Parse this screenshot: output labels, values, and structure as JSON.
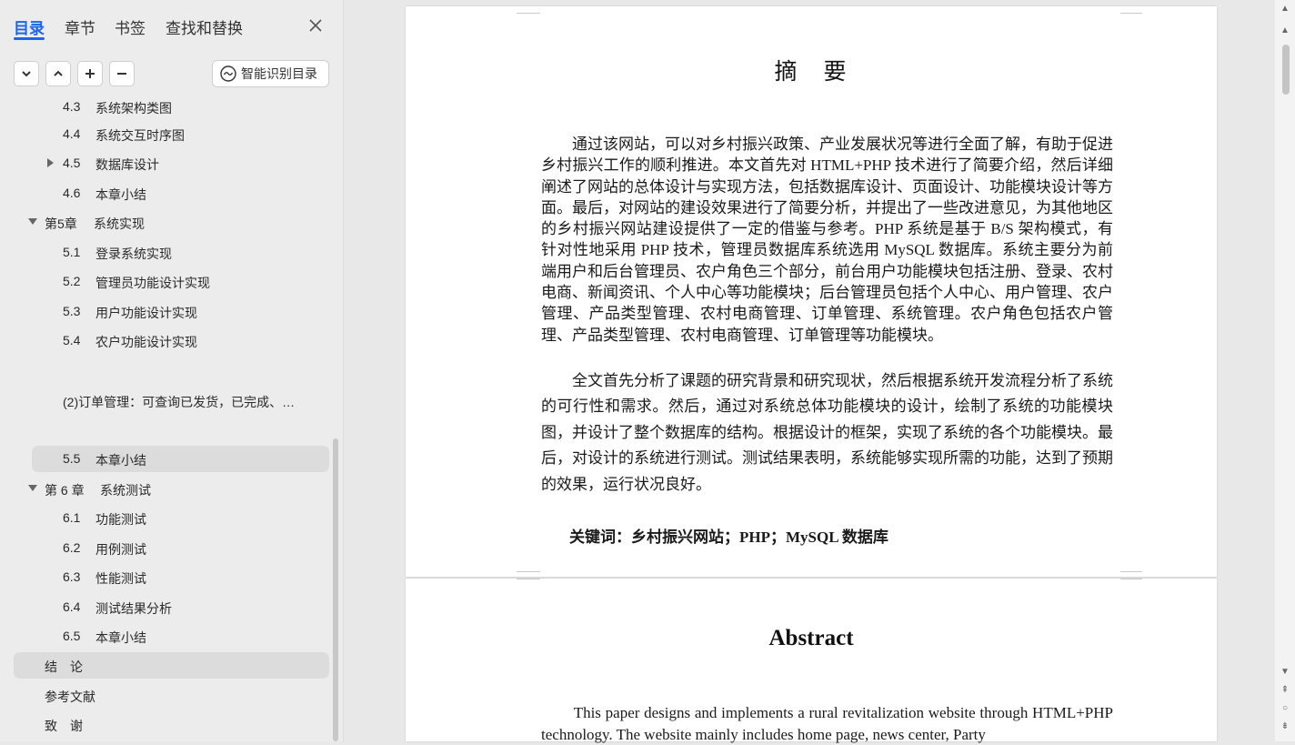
{
  "sidebar": {
    "tabs": [
      {
        "label": "目录"
      },
      {
        "label": "章节"
      },
      {
        "label": "书签"
      },
      {
        "label": "查找和替换"
      }
    ],
    "smart_button_label": "智能识别目录",
    "toc": [
      {
        "num": "4.3",
        "title": "系统架构类图"
      },
      {
        "num": "4.4",
        "title": "系统交互时序图"
      },
      {
        "num": "4.5",
        "title": "数据库设计"
      },
      {
        "num": "4.6",
        "title": "本章小结"
      },
      {
        "num": "第5章",
        "title": "系统实现"
      },
      {
        "num": "5.1",
        "title": "登录系统实现"
      },
      {
        "num": "5.2",
        "title": "管理员功能设计实现"
      },
      {
        "num": "5.3",
        "title": "用户功能设计实现"
      },
      {
        "num": "5.4",
        "title": "农户功能设计实现"
      },
      {
        "num": "",
        "title": "(2)订单管理：可查询已发货，已完成、…"
      },
      {
        "num": "5.5",
        "title": "本章小结"
      },
      {
        "num": "第 6 章",
        "title": "系统测试"
      },
      {
        "num": "6.1",
        "title": "功能测试"
      },
      {
        "num": "6.2",
        "title": "用例测试"
      },
      {
        "num": "6.3",
        "title": "性能测试"
      },
      {
        "num": "6.4",
        "title": "测试结果分析"
      },
      {
        "num": "6.5",
        "title": "本章小结"
      },
      {
        "num": "",
        "title": "结　论"
      },
      {
        "num": "",
        "title": "参考文献"
      },
      {
        "num": "",
        "title": "致　谢"
      }
    ]
  },
  "document": {
    "page1": {
      "title": "摘　要",
      "paragraph1": "通过该网站，可以对乡村振兴政策、产业发展状况等进行全面了解，有助于促进乡村振兴工作的顺利推进。本文首先对 HTML+PHP 技术进行了简要介绍，然后详细阐述了网站的总体设计与实现方法，包括数据库设计、页面设计、功能模块设计等方面。最后，对网站的建设效果进行了简要分析，并提出了一些改进意见，为其他地区的乡村振兴网站建设提供了一定的借鉴与参考。PHP 系统是基于 B/S 架构模式，有针对性地采用 PHP 技术，管理员数据库系统选用 MySQL 数据库。系统主要分为前端用户和后台管理员、农户角色三个部分，前台用户功能模块包括注册、登录、农村电商、新闻资讯、个人中心等功能模块；后台管理员包括个人中心、用户管理、农户管理、产品类型管理、农村电商管理、订单管理、系统管理。农户角色包括农户管理、产品类型管理、农村电商管理、订单管理等功能模块。",
      "paragraph2": "全文首先分析了课题的研究背景和研究现状，然后根据系统开发流程分析了系统的可行性和需求。然后，通过对系统总体功能模块的设计，绘制了系统的功能模块图，并设计了整个数据库的结构。根据设计的框架，实现了系统的各个功能模块。最后，对设计的系统进行测试。测试结果表明，系统能够实现所需的功能，达到了预期的效果，运行状况良好。",
      "keywords_label": "关键词：",
      "keywords_value": "乡村振兴网站；PHP；MySQL 数据库"
    },
    "page2": {
      "title": "Abstract",
      "paragraph1": "This paper designs and implements a rural revitalization website through HTML+PHP technology. The website mainly includes home page, news center, Party"
    }
  }
}
